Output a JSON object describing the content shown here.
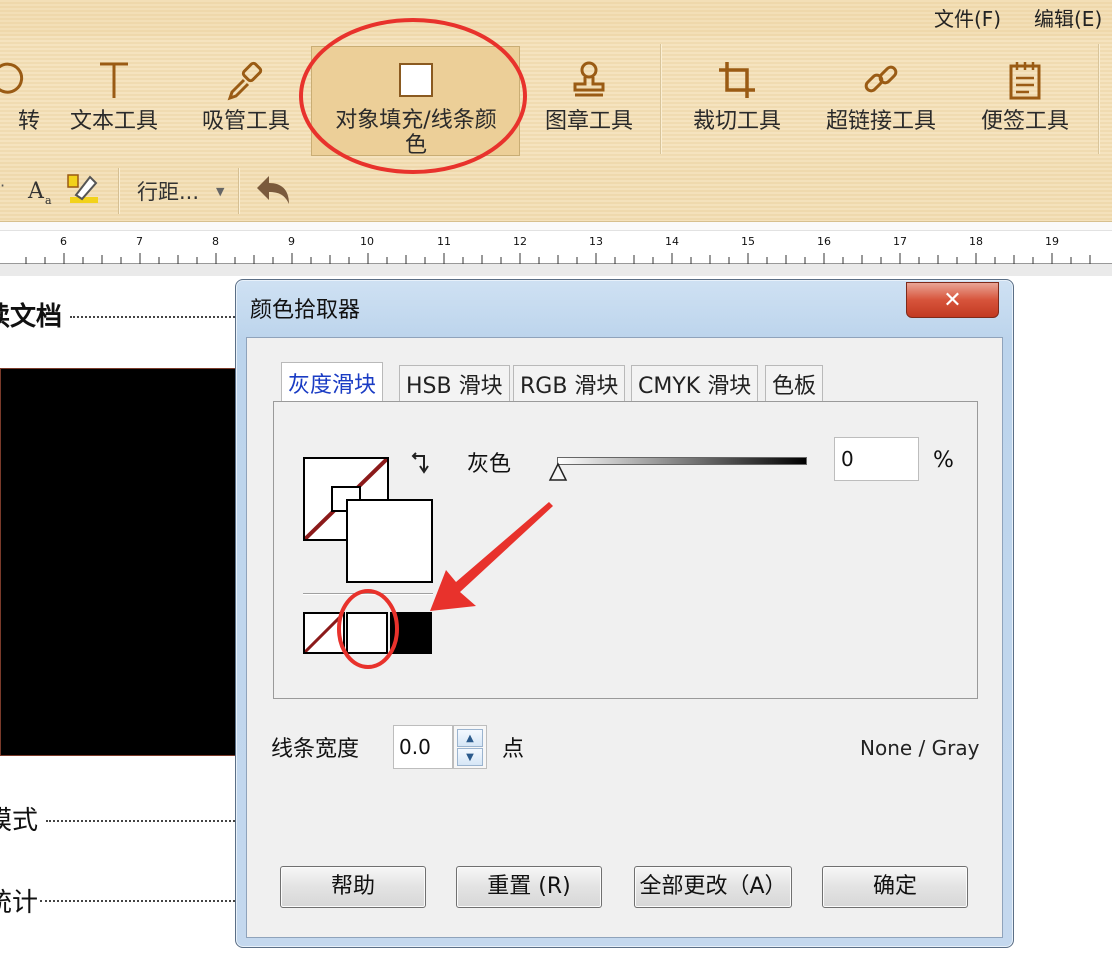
{
  "menu": {
    "file": "文件(F)",
    "edit": "编辑(E)"
  },
  "toolbar": {
    "rotate_partial": "转",
    "text_tool": "文本工具",
    "eyedropper_tool": "吸管工具",
    "fill_line_color_line1": "对象填充/线条颜",
    "fill_line_color_line2": "色",
    "stamp_tool": "图章工具",
    "crop_tool": "裁切工具",
    "hyperlink_tool": "超链接工具",
    "note_tool": "便签工具"
  },
  "toolbar2": {
    "line_spacing": "行距..."
  },
  "ruler": {
    "ticks": [
      "6",
      "7",
      "8",
      "9",
      "10",
      "11",
      "12",
      "13",
      "14",
      "15",
      "16",
      "17",
      "18",
      "19"
    ]
  },
  "document": {
    "line1": "读文档",
    "line2": "模式",
    "line3": "统计"
  },
  "dialog": {
    "title": "颜色拾取器",
    "close": "✕",
    "tabs": [
      "灰度滑块",
      "HSB 滑块",
      "RGB 滑块",
      "CMYK 滑块",
      "色板"
    ],
    "gray_label": "灰色",
    "gray_value": "0",
    "percent": "%",
    "line_width_label": "线条宽度",
    "line_width_value": "0.0",
    "unit": "点",
    "mode": "None / Gray",
    "buttons": {
      "help": "帮助",
      "reset": "重置 (R)",
      "apply_all": "全部更改（A）",
      "ok": "确定"
    }
  },
  "colors": {
    "annotation_red": "#e8322c",
    "active_tab_text": "#1a3cc4",
    "toolbar_icon": "#9a5b14"
  }
}
